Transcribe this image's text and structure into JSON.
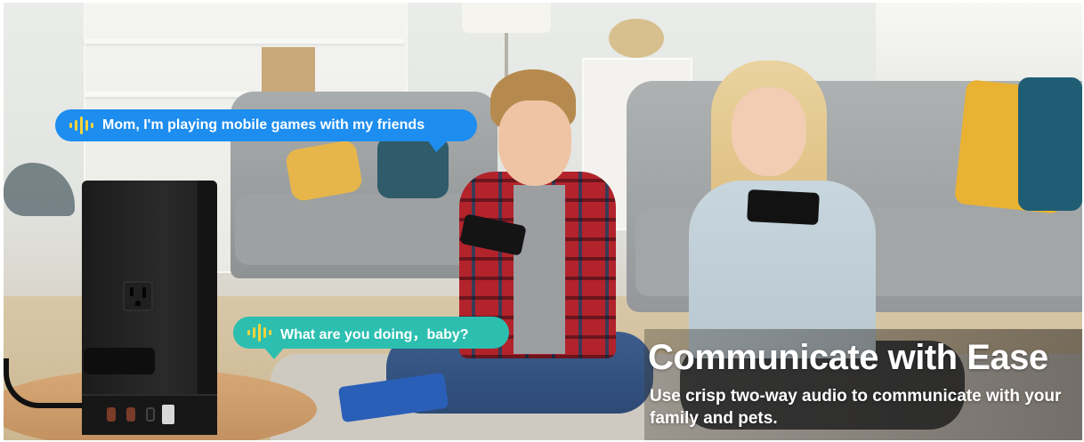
{
  "bubbles": {
    "kid_message": "Mom, I'm playing mobile games with my friends",
    "parent_message": "What are you doing，baby?"
  },
  "caption": {
    "headline": "Communicate with Ease",
    "subline": "Use crisp two-way audio to communicate with your family and pets."
  },
  "icons": [
    "voice-wave-icon"
  ],
  "colors": {
    "bubble_blue": "#1d8df0",
    "bubble_teal": "#2cbfb0",
    "wave_yellow": "#f6d43a"
  }
}
